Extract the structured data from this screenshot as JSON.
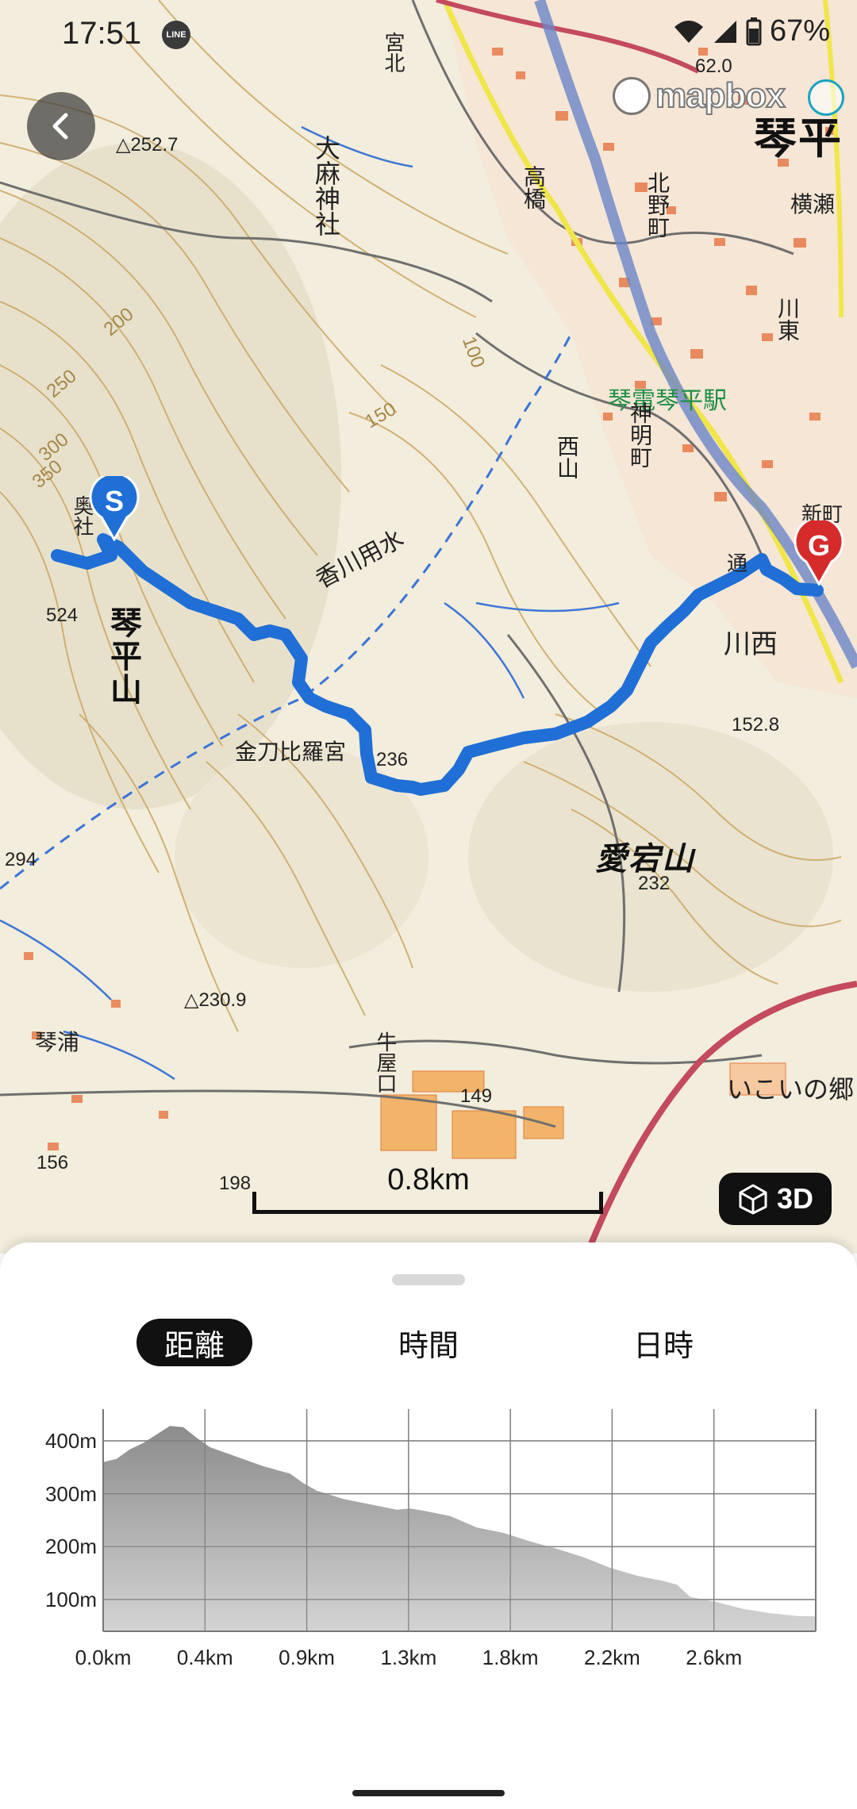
{
  "status_bar": {
    "time": "17:51",
    "notification_icon": "line-app-icon",
    "notification_text": "LINE",
    "battery": "67%"
  },
  "map": {
    "attribution": "mapbox",
    "scale_label": "0.8km",
    "button_3d_label": "3D",
    "start_marker": "S",
    "goal_marker": "G",
    "labels": {
      "kotohira_yama": "琴平山",
      "atago_yama": "愛宕山",
      "kawanishi": "川西",
      "ikoi_no_sato": "いこいの郷",
      "station": "琴電琴平駅",
      "kagawa_yosui": "香川用水",
      "konpira_gu": "金刀比羅宮",
      "omahijinja": "大麻神社",
      "kotohira_town": "琴平",
      "kitano_machi": "北野町",
      "shinmei_machi": "神明町",
      "kawahigashi": "川東",
      "yokose": "横瀬",
      "nishiyama": "西山",
      "shinmachi": "新町",
      "takahashi": "高橋",
      "kotoura": "琴浦",
      "okusha": "奥社",
      "miyakita": "宮北",
      "dori": "通",
      "yashiroguchi": "牛屋口",
      "elev_252": "△252.7",
      "elev_230": "△230.9",
      "elev_524": "524",
      "elev_236": "236",
      "elev_232": "232",
      "elev_152": "152.8",
      "elev_149": "149",
      "elev_294": "294",
      "elev_156": "156",
      "elev_198": "198",
      "elev_62": "62.0",
      "contour_300": "300",
      "contour_250": "250",
      "contour_200": "200",
      "contour_150": "150",
      "contour_100": "100",
      "contour_350": "350"
    }
  },
  "sheet": {
    "tabs": [
      {
        "label": "距離",
        "active": true
      },
      {
        "label": "時間",
        "active": false
      },
      {
        "label": "日時",
        "active": false
      }
    ]
  },
  "chart_data": {
    "type": "area",
    "title": "",
    "xlabel": "",
    "ylabel": "",
    "x_tick_labels": [
      "0.0km",
      "0.4km",
      "0.9km",
      "1.3km",
      "1.8km",
      "2.2km",
      "2.6km"
    ],
    "y_tick_labels": [
      "400m",
      "300m",
      "200m",
      "100m"
    ],
    "y_ticks": [
      400,
      300,
      200,
      100
    ],
    "xlim": [
      0,
      2.67
    ],
    "ylim": [
      40,
      460
    ],
    "grid": true,
    "x": [
      0.0,
      0.05,
      0.1,
      0.15,
      0.2,
      0.25,
      0.3,
      0.35,
      0.4,
      0.5,
      0.6,
      0.7,
      0.75,
      0.8,
      0.9,
      1.0,
      1.1,
      1.15,
      1.2,
      1.3,
      1.4,
      1.5,
      1.6,
      1.7,
      1.8,
      1.9,
      2.0,
      2.1,
      2.15,
      2.2,
      2.3,
      2.4,
      2.5,
      2.6,
      2.67
    ],
    "y": [
      360,
      366,
      384,
      396,
      412,
      428,
      426,
      406,
      388,
      370,
      352,
      338,
      320,
      306,
      290,
      280,
      270,
      272,
      268,
      258,
      236,
      226,
      210,
      196,
      180,
      160,
      145,
      135,
      128,
      105,
      95,
      82,
      74,
      69,
      68
    ]
  }
}
